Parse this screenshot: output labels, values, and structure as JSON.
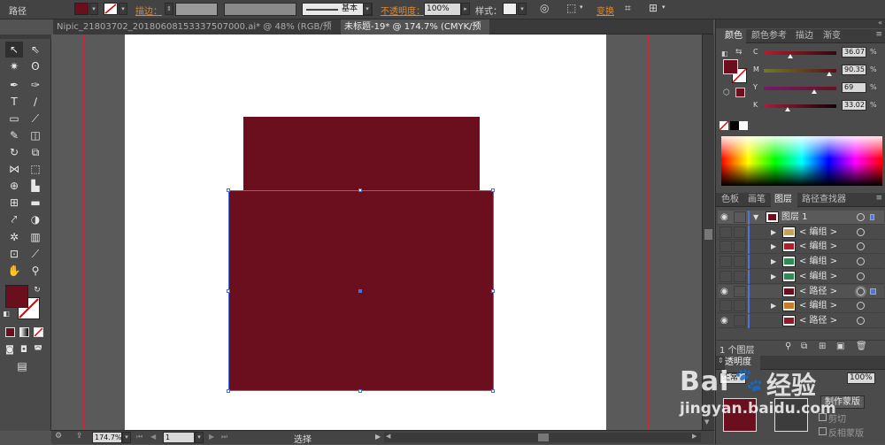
{
  "control_bar": {
    "object_type": "路径",
    "fill_color": "#6b0f1e",
    "stroke_label": "描边：",
    "stroke_profile": "基本",
    "opacity_label": "不透明度：",
    "opacity_value": "100%",
    "style_label": "样式：",
    "transform_label": "变换"
  },
  "doc_tabs": [
    {
      "label": "Nipic_21803702_20180608153337507000.ai* @ 48% (RGB/预览)"
    },
    {
      "label": "未标题-19* @ 174.7% (CMYK/预览)"
    }
  ],
  "artwork": {
    "shape_color": "#6b0f1e"
  },
  "status_bar": {
    "zoom": "174.7%",
    "artboard_number": "1",
    "tool_status": "选择"
  },
  "color_panel": {
    "tabs": [
      "颜色",
      "颜色参考",
      "描边",
      "渐变"
    ],
    "channels": [
      {
        "label": "C",
        "value": "36.07",
        "gradient_start": "#b71c2b",
        "gradient_end": "#2b0a12",
        "thumb_fraction": 0.36
      },
      {
        "label": "M",
        "value": "90.35",
        "gradient_start": "#6e7b2a",
        "gradient_end": "#5c0e1e",
        "thumb_fraction": 0.9
      },
      {
        "label": "Y",
        "value": "69",
        "gradient_start": "#7a1a6a",
        "gradient_end": "#6b1020",
        "thumb_fraction": 0.69
      },
      {
        "label": "K",
        "value": "33.02",
        "gradient_start": "#a81f3f",
        "gradient_end": "#0f0205",
        "thumb_fraction": 0.33
      }
    ]
  },
  "layers_panel": {
    "tabs": [
      "色板",
      "画笔",
      "图层",
      "路径查找器"
    ],
    "layers": [
      {
        "name": "图层 1",
        "visible": true,
        "expanded": true,
        "thumb_color": "#6b0f1e"
      },
      {
        "name": "< 编组 >",
        "visible": false,
        "has_children": true,
        "thumb_color": "#c9a25a"
      },
      {
        "name": "< 编组 >",
        "visible": false,
        "has_children": true,
        "thumb_color": "#b21d26"
      },
      {
        "name": "< 编组 >",
        "visible": false,
        "has_children": true,
        "thumb_color": "#2e8b57"
      },
      {
        "name": "< 编组 >",
        "visible": false,
        "has_children": true,
        "thumb_color": "#2e8b57"
      },
      {
        "name": "< 路径 >",
        "visible": true,
        "has_children": false,
        "thumb_color": "#6b0f1e",
        "selected": true
      },
      {
        "name": "< 编组 >",
        "visible": false,
        "has_children": true,
        "thumb_color": "#c97a2a"
      },
      {
        "name": "< 路径 >",
        "visible": true,
        "has_children": false,
        "thumb_color": "#8b1a2a"
      }
    ],
    "footer_count": "1 个图层"
  },
  "transparency_panel": {
    "title": "透明度",
    "blend_mode": "正常",
    "opacity_value": "100%",
    "make_mask_button": "制作蒙版",
    "clip_label": "剪切",
    "invert_label": "反相蒙版"
  },
  "watermark": {
    "brand_left": "Bai",
    "brand_right": "经验",
    "url": "jingyan.baidu.com"
  }
}
